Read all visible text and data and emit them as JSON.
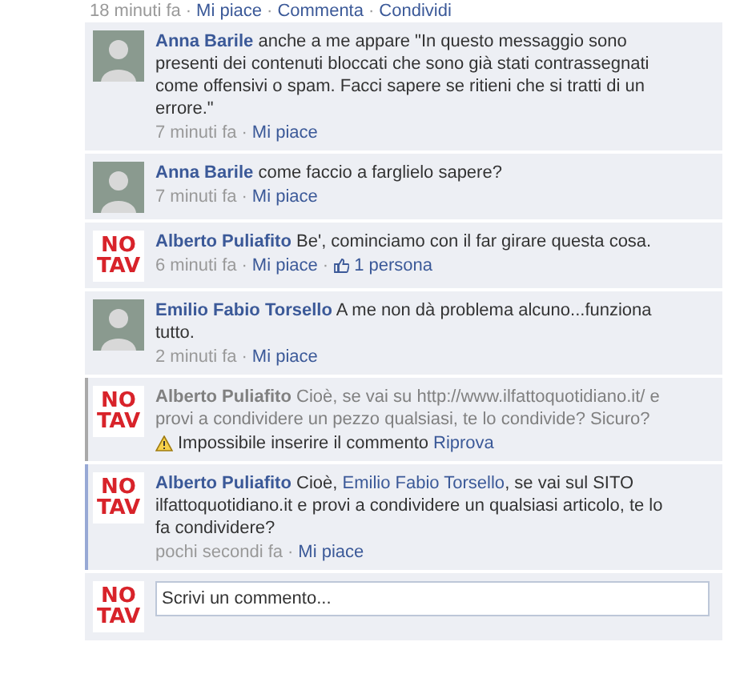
{
  "post_actions": [
    {
      "kind": "time",
      "text": "18 minuti fa"
    },
    {
      "kind": "sep",
      "text": "·"
    },
    {
      "kind": "link",
      "text": "Mi piace"
    },
    {
      "kind": "sep",
      "text": "·"
    },
    {
      "kind": "link",
      "text": "Commenta"
    },
    {
      "kind": "sep",
      "text": "·"
    },
    {
      "kind": "link",
      "text": "Condividi"
    }
  ],
  "comments": [
    {
      "kind": "normal",
      "avatar": {
        "kind": "photo"
      },
      "author": "Anna Barile",
      "parts": [
        {
          "text": "anche a me appare \"In questo messaggio sono presenti dei contenuti bloccati che sono già stati contrassegnati come offensivi o spam. Facci sapere se ritieni che si tratti di un errore.\"",
          "link": false
        }
      ],
      "meta": [
        {
          "kind": "time",
          "text": "7 minuti fa"
        },
        {
          "kind": "sep",
          "text": "·"
        },
        {
          "kind": "link",
          "text": "Mi piace"
        }
      ]
    },
    {
      "kind": "normal",
      "avatar": {
        "kind": "photo"
      },
      "author": "Anna Barile",
      "parts": [
        {
          "text": "come faccio a farglielo sapere?",
          "link": false
        }
      ],
      "meta": [
        {
          "kind": "time",
          "text": "7 minuti fa"
        },
        {
          "kind": "sep",
          "text": "·"
        },
        {
          "kind": "link",
          "text": "Mi piace"
        }
      ]
    },
    {
      "kind": "normal",
      "avatar": {
        "kind": "logo",
        "lines": [
          "NO",
          "TAV"
        ]
      },
      "author": "Alberto Puliafito",
      "parts": [
        {
          "text": "Be', cominciamo con il far girare questa cosa.",
          "link": false
        }
      ],
      "meta": [
        {
          "kind": "time",
          "text": "6 minuti fa"
        },
        {
          "kind": "sep",
          "text": "·"
        },
        {
          "kind": "link",
          "text": "Mi piace"
        },
        {
          "kind": "sep",
          "text": "·"
        },
        {
          "kind": "likes",
          "text": "1 persona"
        }
      ]
    },
    {
      "kind": "normal",
      "avatar": {
        "kind": "photo"
      },
      "author": "Emilio Fabio Torsello",
      "parts": [
        {
          "text": "A me non dà problema alcuno...funziona tutto.",
          "link": false
        }
      ],
      "meta": [
        {
          "kind": "time",
          "text": "2 minuti fa"
        },
        {
          "kind": "sep",
          "text": "·"
        },
        {
          "kind": "link",
          "text": "Mi piace"
        }
      ]
    },
    {
      "kind": "failed",
      "avatar": {
        "kind": "logo",
        "lines": [
          "NO",
          "TAV"
        ]
      },
      "author": "Alberto Puliafito",
      "parts": [
        {
          "text": "Cioè, se vai su http://www.ilfattoquotidiano.it/ e provi a condividere un pezzo qualsiasi, te lo condivide? Sicuro?",
          "link": false
        }
      ],
      "meta": [
        {
          "kind": "error",
          "text": "Impossibile inserire il commento"
        },
        {
          "kind": "link",
          "text": "Riprova"
        }
      ]
    },
    {
      "kind": "recent",
      "avatar": {
        "kind": "logo",
        "lines": [
          "NO",
          "TAV"
        ]
      },
      "author": "Alberto Puliafito",
      "parts": [
        {
          "text": "Cioè, ",
          "link": false
        },
        {
          "text": "Emilio Fabio Torsello",
          "link": true
        },
        {
          "text": ", se vai sul SITO ilfattoquotidiano.it e provi a condividere un qualsiasi articolo, te lo fa condividere?",
          "link": false
        }
      ],
      "meta": [
        {
          "kind": "time",
          "text": "pochi secondi fa"
        },
        {
          "kind": "sep",
          "text": "·"
        },
        {
          "kind": "link",
          "text": "Mi piace"
        }
      ]
    }
  ],
  "composer": {
    "avatar": {
      "kind": "logo",
      "lines": [
        "NO",
        "TAV"
      ]
    },
    "placeholder": "Scrivi un commento..."
  }
}
